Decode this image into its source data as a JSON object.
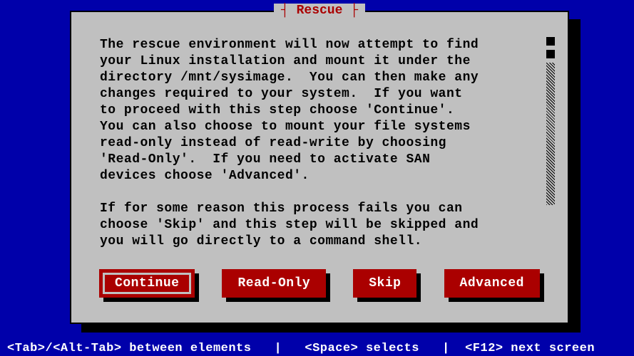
{
  "dialog": {
    "title": "Rescue",
    "body": "The rescue environment will now attempt to find\nyour Linux installation and mount it under the\ndirectory /mnt/sysimage.  You can then make any\nchanges required to your system.  If you want\nto proceed with this step choose 'Continue'.\nYou can also choose to mount your file systems\nread-only instead of read-write by choosing\n'Read-Only'.  If you need to activate SAN\ndevices choose 'Advanced'.\n\nIf for some reason this process fails you can\nchoose 'Skip' and this step will be skipped and\nyou will go directly to a command shell."
  },
  "buttons": {
    "continue": "Continue",
    "readonly": "Read-Only",
    "skip": "Skip",
    "advanced": "Advanced"
  },
  "status_bar": "<Tab>/<Alt-Tab> between elements   |   <Space> selects   |  <F12> next screen",
  "colors": {
    "background": "#0000aa",
    "panel": "#c0c0c0",
    "accent": "#aa0000"
  },
  "focused_button": "continue"
}
